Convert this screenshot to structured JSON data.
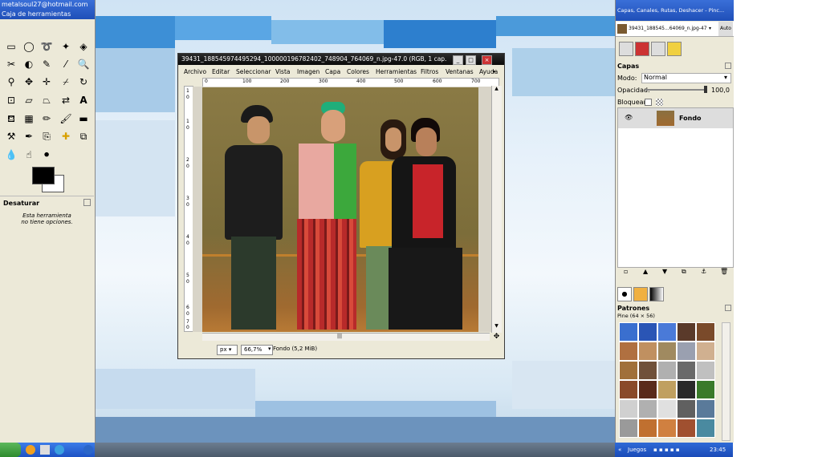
{
  "toolbox": {
    "window_title": "metalsoul27@hotmail.com",
    "title": "Caja de herramientas",
    "options_title": "Desaturar",
    "options_text_1": "Esta herramienta",
    "options_text_2": "no tiene opciones."
  },
  "image_window": {
    "title": "39431_188545974495294_100000196782402_748904_764069_n.jpg-47.0 (RGB, 1 cap...",
    "menu": [
      "Archivo",
      "Editar",
      "Seleccionar",
      "Vista",
      "Imagen",
      "Capa",
      "Colores",
      "Herramientas",
      "Filtros",
      "Ventanas",
      "Ayuda"
    ],
    "ruler_ticks": [
      "0",
      "100",
      "200",
      "300",
      "400",
      "500",
      "600",
      "700"
    ],
    "ruler_v_ticks": [
      "1",
      "0",
      "1",
      "0",
      "2",
      "0",
      "3",
      "0",
      "4",
      "0",
      "5",
      "0",
      "6",
      "0",
      "7",
      "0"
    ],
    "unit": "px",
    "zoom": "66,7%",
    "status": "Fondo (5,2 MiB)"
  },
  "dock": {
    "title": "Capas, Canales, Rutas, Deshacer - Pinc...",
    "image_selector": "39431_188545...64069_n.jpg-47",
    "auto_button": "Auto",
    "layers_title": "Capas",
    "mode_label": "Modo:",
    "mode_value": "Normal",
    "opacity_label": "Opacidad:",
    "opacity_value": "100,0",
    "opacity_fraction": 1.0,
    "lock_label": "Bloquear:",
    "layer_name": "Fondo",
    "patterns_title": "Patrones",
    "pattern_name": "Pine (64 × 56)"
  },
  "taskbar": {
    "games": "Juegos",
    "clock": "23:45"
  },
  "colors": {
    "foreground": "#000000",
    "background": "#ffffff",
    "titlebar": "#1f4fb8"
  },
  "patterns": [
    "#3a6fcf",
    "#2a55b5",
    "#4a7ad8",
    "#5a3a2a",
    "#7a4a2a",
    "#b07040",
    "#c09060",
    "#a08a60",
    "#9aa0b0",
    "#d0b090",
    "#a0703a",
    "#70513a",
    "#b0b0b0",
    "#6a6a6a",
    "#c0c0c0",
    "#8a4a2a",
    "#5a2a1a",
    "#c0a060",
    "#2a2a2a",
    "#3a7a2a",
    "#d0d0d0",
    "#b0b0b0",
    "#e0e0e0",
    "#606060",
    "#5a7a9a",
    "#9a9a9a",
    "#c07030",
    "#d08040",
    "#a05030",
    "#4a8aa0"
  ]
}
